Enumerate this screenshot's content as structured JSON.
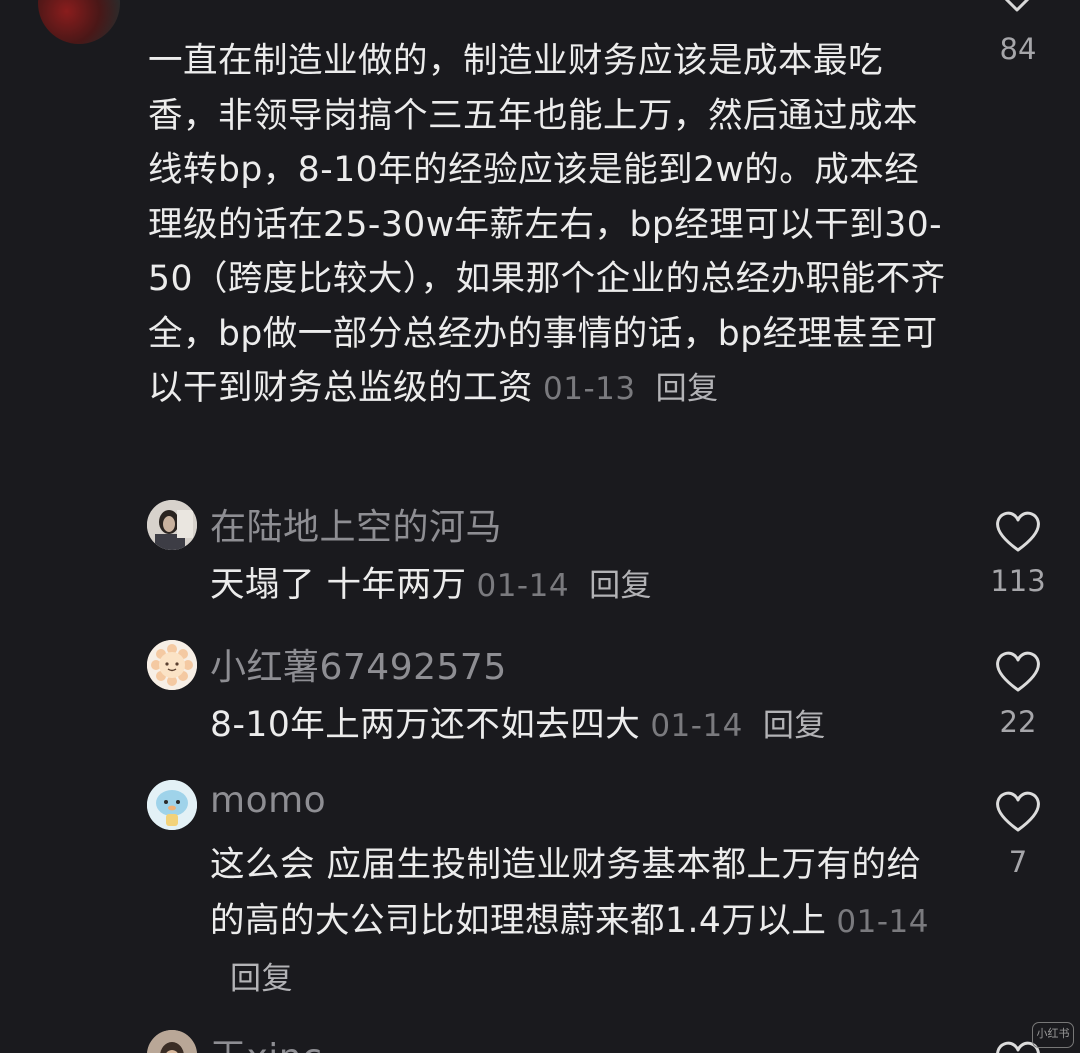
{
  "comment": {
    "text": "一直在制造业做的，制造业财务应该是成本最吃香，非领导岗搞个三五年也能上万，然后通过成本线转bp，8-10年的经验应该是能到2w的。成本经理级的话在25-30w年薪左右，bp经理可以干到30-50（跨度比较大），如果那个企业的总经办职能不齐全，bp做一部分总经办的事情的话，bp经理甚至可以干到财务总监级的工资",
    "date": "01-13",
    "reply_label": "回复",
    "likes": "84"
  },
  "replies": [
    {
      "username": "在陆地上空的河马",
      "text": "天塌了 十年两万",
      "date": "01-14",
      "reply_label": "回复",
      "likes": "113"
    },
    {
      "username": "小红薯67492575",
      "text": "8-10年上两万还不如去四大",
      "date": "01-14",
      "reply_label": "回复",
      "likes": "22"
    },
    {
      "username": "momo",
      "text": "这么会 应届生投制造业财务基本都上万有的给的高的大公司比如理想蔚来都1.4万以上",
      "date": "01-14",
      "reply_label": "回复",
      "likes": "7"
    },
    {
      "username": "王xinc"
    }
  ],
  "watermark": "小红书",
  "colors": {
    "background": "#1a1a1e",
    "text": "#ececec",
    "muted": "#8e8e93"
  }
}
